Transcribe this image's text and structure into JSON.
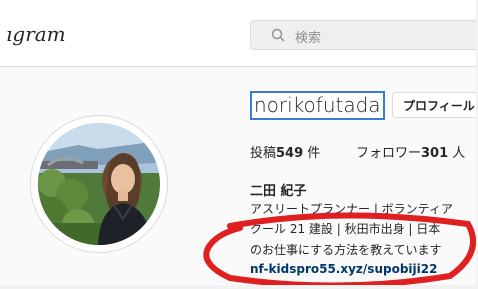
{
  "header": {
    "logo_text": "ıgram",
    "search": {
      "placeholder": "検索",
      "icon": "search-icon"
    }
  },
  "profile": {
    "username": "norikofutada",
    "profile_button_label": "プロフィール",
    "stats": [
      {
        "label": "投稿",
        "count": "549",
        "suffix": " 件"
      },
      {
        "label": "フォロワー",
        "count": "301",
        "suffix": " 人"
      }
    ],
    "full_name": "二田 紀子",
    "bio_lines": [
      "アスリートプランナー | ボランティア",
      "クール 21 建設 | 秋田市出身 | 日本",
      "のお仕事にする方法を教えています"
    ],
    "link": "nf-kidspro55.xyz/supobiji22"
  },
  "annotation": {
    "color": "#e02020"
  }
}
